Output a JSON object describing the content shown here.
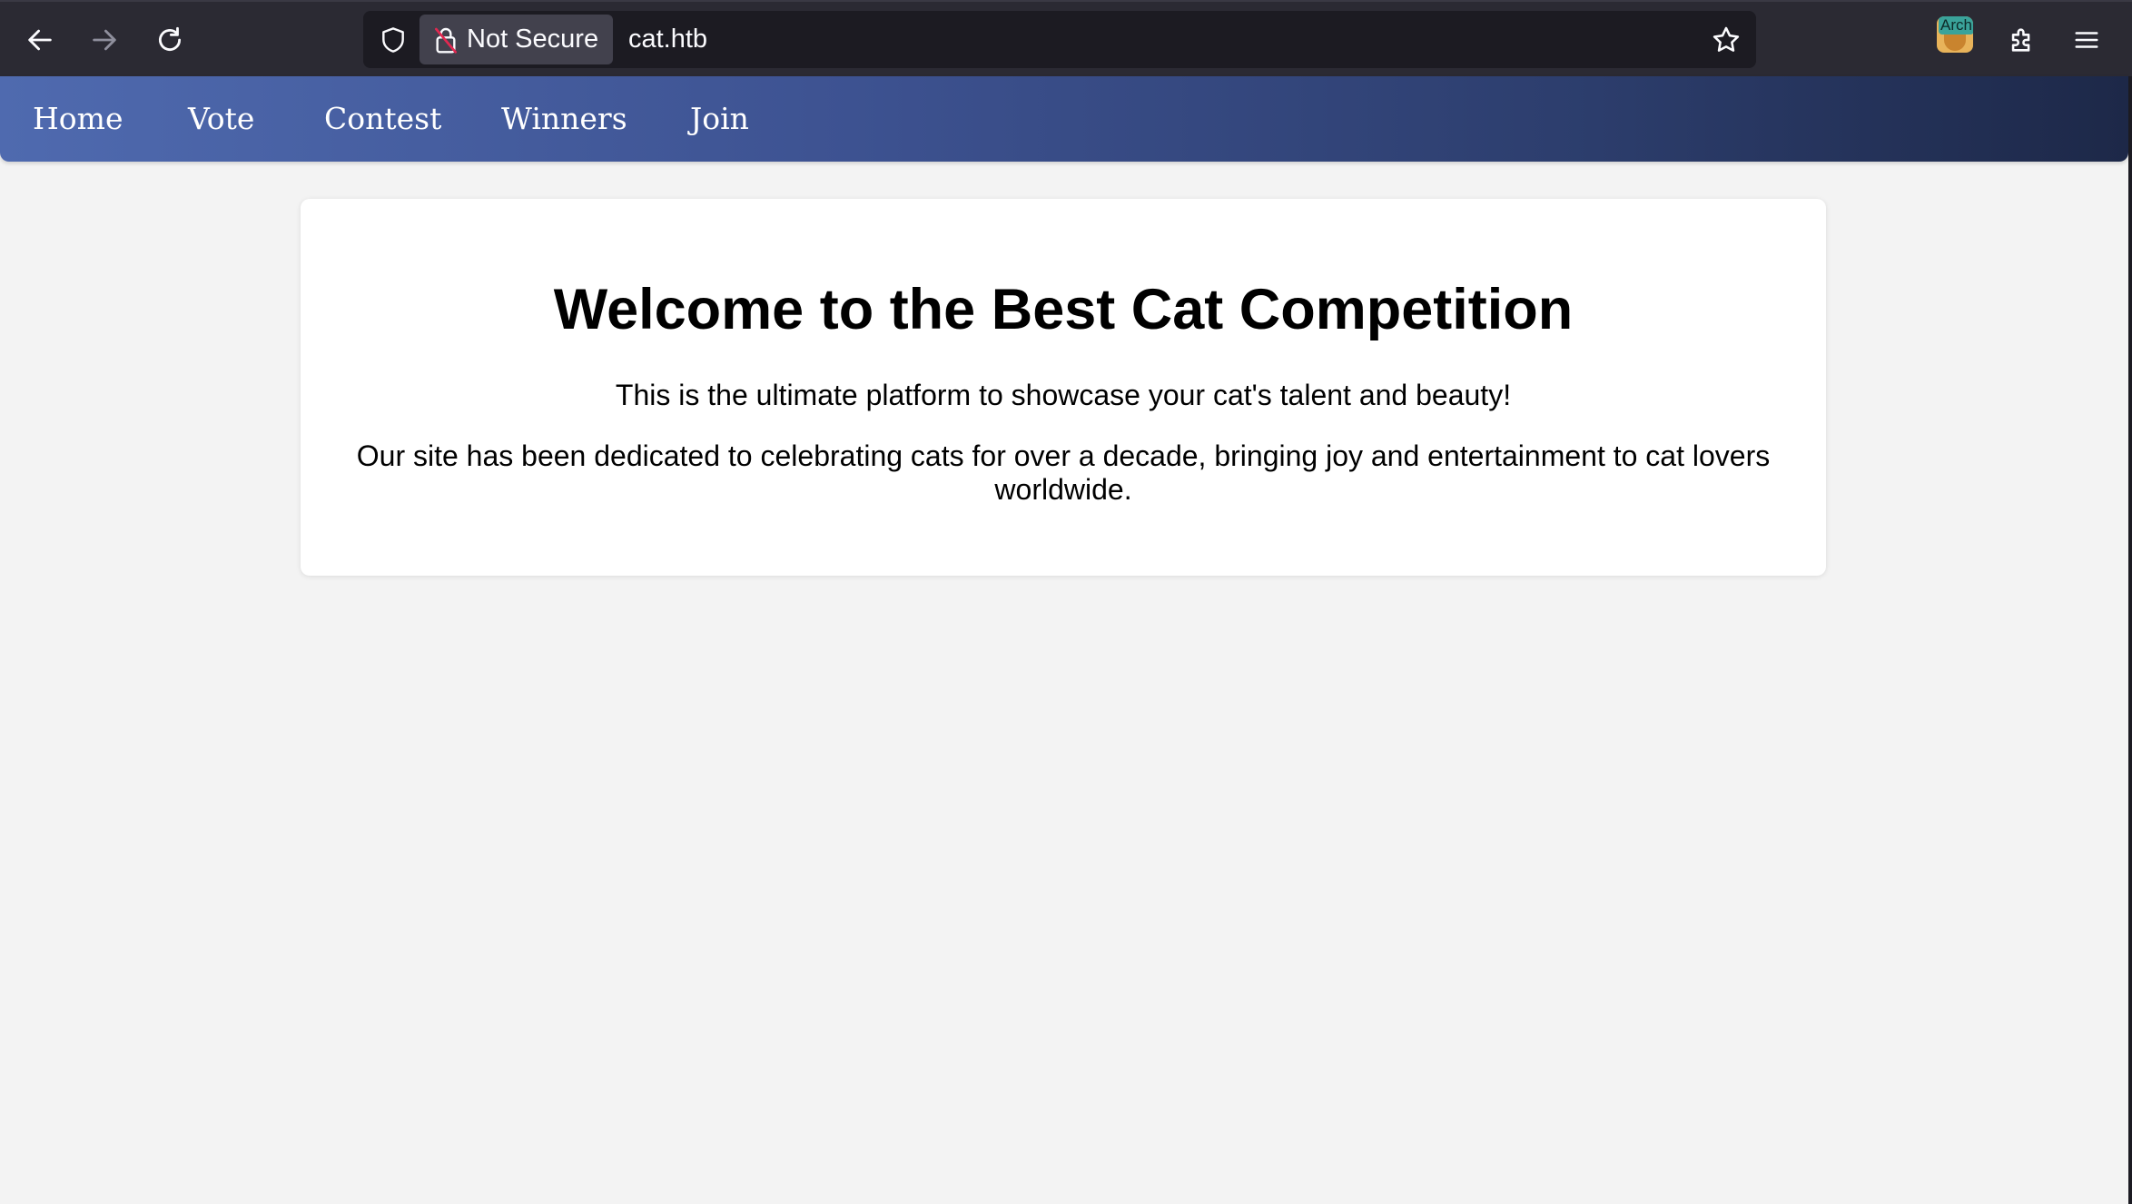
{
  "browser": {
    "security_label": "Not Secure",
    "url": "cat.htb",
    "extension_badge": "Arch",
    "icons": {
      "back": "arrow-left-icon",
      "forward": "arrow-right-icon",
      "reload": "reload-icon",
      "shield": "shield-icon",
      "lock": "broken-lock-icon",
      "bookmark": "star-icon",
      "extensions": "puzzle-icon",
      "menu": "hamburger-menu-icon"
    }
  },
  "nav": {
    "items": [
      {
        "label": "Home"
      },
      {
        "label": "Vote"
      },
      {
        "label": "Contest"
      },
      {
        "label": "Winners"
      },
      {
        "label": "Join"
      }
    ]
  },
  "content": {
    "title": "Welcome to the Best Cat Competition",
    "intro": "This is the ultimate platform to showcase your cat's talent and beauty!",
    "description": "Our site has been dedicated to celebrating cats for over a decade, bringing joy and entertainment to cat lovers worldwide."
  },
  "colors": {
    "nav_gradient_start": "#4f6aaf",
    "nav_gradient_end": "#1d2848",
    "page_background": "#f3f3f3",
    "toolbar_background": "#2b2a33"
  }
}
